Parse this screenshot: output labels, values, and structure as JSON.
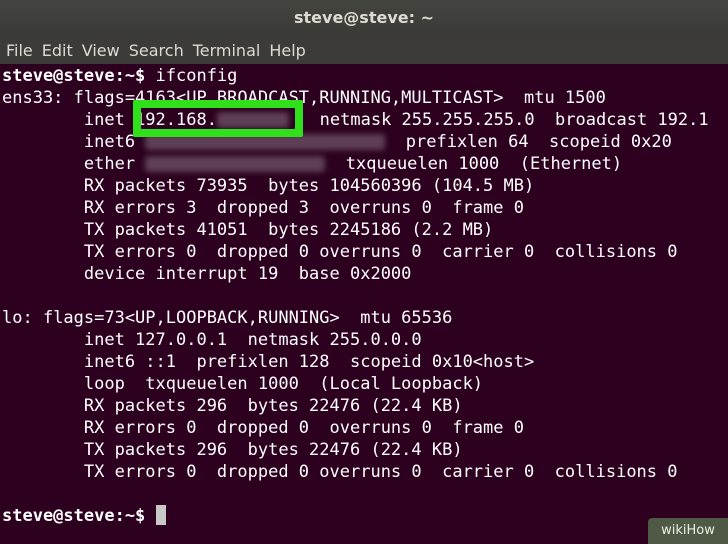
{
  "window": {
    "title": "steve@steve: ~"
  },
  "menu": [
    "File",
    "Edit",
    "View",
    "Search",
    "Terminal",
    "Help"
  ],
  "terminal": {
    "line1_prompt": "steve@steve:~$",
    "line1_cmd": " ifconfig",
    "line2": "ens33: flags=4163<UP,BROADCAST,RUNNING,MULTICAST>  mtu 1500",
    "line3_pre": "        inet ",
    "line3_ip": "192.168.",
    "line3_post": "   netmask 255.255.255.0  broadcast 192.1",
    "line4_pre": "        inet6 ",
    "line4_post": "  prefixlen 64  scopeid 0x20",
    "line5_pre": "        ether ",
    "line5_post": "  txqueuelen 1000  (Ethernet)",
    "line6": "        RX packets 73935  bytes 104560396 (104.5 MB)",
    "line7": "        RX errors 3  dropped 3  overruns 0  frame 0",
    "line8": "        TX packets 41051  bytes 2245186 (2.2 MB)",
    "line9": "        TX errors 0  dropped 0 overruns 0  carrier 0  collisions 0",
    "line10": "        device interrupt 19  base 0x2000",
    "line11": "",
    "line12": "lo: flags=73<UP,LOOPBACK,RUNNING>  mtu 65536",
    "line13": "        inet 127.0.0.1  netmask 255.0.0.0",
    "line14": "        inet6 ::1  prefixlen 128  scopeid 0x10<host>",
    "line15": "        loop  txqueuelen 1000  (Local Loopback)",
    "line16": "        RX packets 296  bytes 22476 (22.4 KB)",
    "line17": "        RX errors 0  dropped 0  overruns 0  frame 0",
    "line18": "        TX packets 296  bytes 22476 (22.4 KB)",
    "line19": "        TX errors 0  dropped 0 overruns 0  carrier 0  collisions 0",
    "line20_prompt": "steve@steve:~$"
  },
  "watermark": "wikiHow",
  "colors": {
    "background": "#2c001e",
    "highlight": "#2fe01b",
    "text": "#ffffff"
  }
}
